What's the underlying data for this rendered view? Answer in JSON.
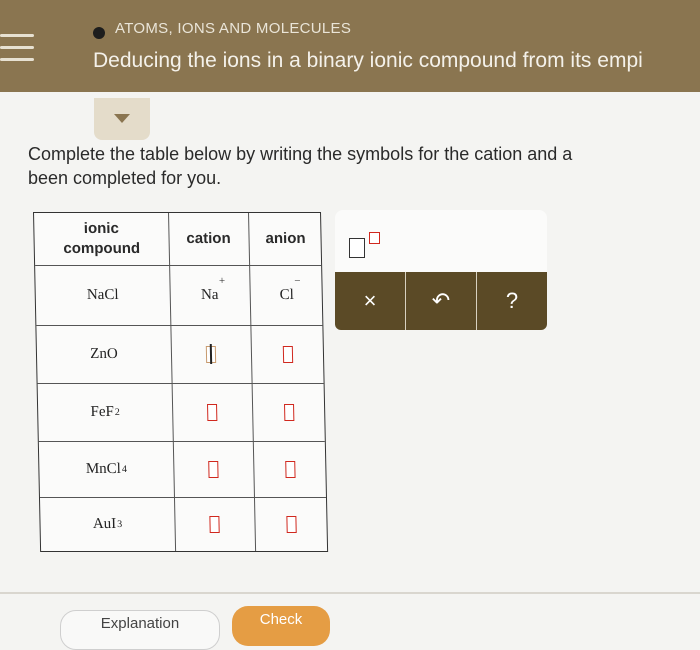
{
  "header": {
    "topic": "ATOMS, IONS AND MOLECULES",
    "lesson_title": "Deducing the ions in a binary ionic compound from its empi"
  },
  "instructions": {
    "line1": "Complete the table below by writing the symbols for the cation and a",
    "line2": "been completed for you."
  },
  "table": {
    "headers": {
      "compound_line1": "ionic",
      "compound_line2": "compound",
      "cation": "cation",
      "anion": "anion"
    },
    "rows": [
      {
        "compound": "NaCl",
        "subscript": "",
        "cation": "Na",
        "cation_charge": "+",
        "anion": "Cl",
        "anion_charge": "−"
      },
      {
        "compound": "ZnO",
        "subscript": "",
        "cation": "",
        "anion": ""
      },
      {
        "compound": "FeF",
        "subscript": "2",
        "cation": "",
        "anion": ""
      },
      {
        "compound": "MnCl",
        "subscript": "4",
        "cation": "",
        "anion": ""
      },
      {
        "compound": "AuI",
        "subscript": "3",
        "cation": "",
        "anion": ""
      }
    ]
  },
  "palette": {
    "buttons": {
      "clear": "×",
      "undo": "↶",
      "help": "?"
    }
  },
  "footer": {
    "explanation_label": "Explanation",
    "check_label": "Check"
  },
  "colors": {
    "header_bg": "#8a7550",
    "toolbar_bg": "#5b4a26",
    "check_bg": "#e59d44",
    "input_border": "#d0281e"
  }
}
